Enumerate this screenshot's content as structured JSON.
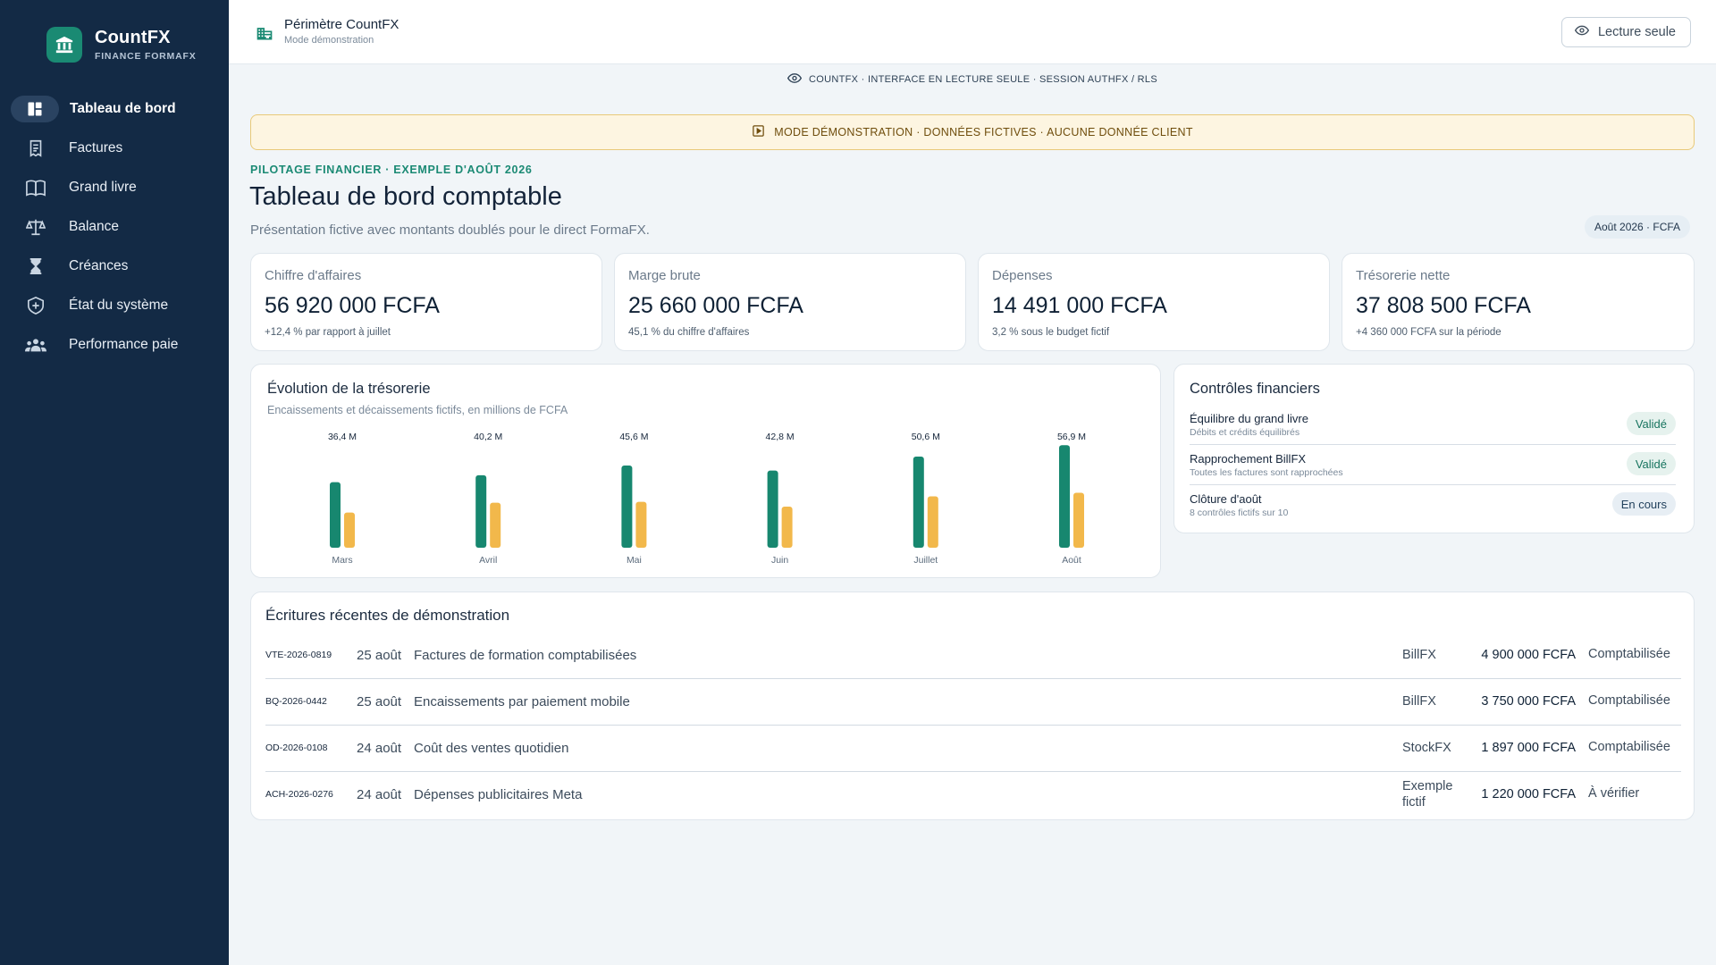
{
  "sidebar": {
    "brand_name": "CountFX",
    "brand_sub": "FINANCE FORMAFX",
    "items": [
      {
        "label": "Tableau de bord",
        "icon": "dashboard-icon"
      },
      {
        "label": "Factures",
        "icon": "receipt-icon"
      },
      {
        "label": "Grand livre",
        "icon": "book-icon"
      },
      {
        "label": "Balance",
        "icon": "scale-icon"
      },
      {
        "label": "Créances",
        "icon": "hourglass-icon"
      },
      {
        "label": "État du système",
        "icon": "shield-icon"
      },
      {
        "label": "Performance paie",
        "icon": "people-icon"
      }
    ]
  },
  "topbar": {
    "title": "Périmètre CountFX",
    "subtitle": "Mode démonstration",
    "readonly_label": "Lecture seule"
  },
  "session_bar": "COUNTFX · INTERFACE EN LECTURE SEULE · SESSION AUTHFX / RLS",
  "demo_banner": "MODE DÉMONSTRATION · DONNÉES FICTIVES · AUCUNE DONNÉE CLIENT",
  "header": {
    "kicker": "PILOTAGE FINANCIER · EXEMPLE D'AOÛT 2026",
    "title": "Tableau de bord comptable",
    "subtitle": "Présentation fictive avec montants doublés pour le direct FormaFX.",
    "period": "Août 2026 · FCFA"
  },
  "kpis": [
    {
      "label": "Chiffre d'affaires",
      "value": "56 920 000 FCFA",
      "note": "+12,4 % par rapport à juillet"
    },
    {
      "label": "Marge brute",
      "value": "25 660 000 FCFA",
      "note": "45,1 % du chiffre d'affaires"
    },
    {
      "label": "Dépenses",
      "value": "14 491 000 FCFA",
      "note": "3,2 % sous le budget fictif"
    },
    {
      "label": "Trésorerie nette",
      "value": "37 808 500 FCFA",
      "note": "+4 360 000 FCFA sur la période"
    }
  ],
  "treasury": {
    "title": "Évolution de la trésorerie",
    "subtitle": "Encaissements et décaissements fictifs, en millions de FCFA",
    "colors": {
      "inflow": "#17876f",
      "outflow": "#f2b84b"
    }
  },
  "chart_data": {
    "type": "bar",
    "categories": [
      "Mars",
      "Avril",
      "Mai",
      "Juin",
      "Juillet",
      "Août"
    ],
    "data_labels": [
      "36,4 M",
      "40,2 M",
      "45,6 M",
      "42,8 M",
      "50,6 M",
      "56,9 M"
    ],
    "series": [
      {
        "values": [
          36.4,
          40.2,
          45.6,
          42.8,
          50.6,
          56.9
        ]
      },
      {
        "values": [
          19.5,
          25.0,
          25.5,
          22.8,
          28.5,
          30.5
        ]
      }
    ],
    "title": "Évolution de la trésorerie",
    "ylim": [
      0,
      60
    ],
    "grid": false
  },
  "controls": {
    "title": "Contrôles financiers",
    "items": [
      {
        "label": "Équilibre du grand livre",
        "desc": "Débits et crédits équilibrés",
        "status": "Validé",
        "kind": "ok"
      },
      {
        "label": "Rapprochement BillFX",
        "desc": "Toutes les factures sont rapprochées",
        "status": "Validé",
        "kind": "ok"
      },
      {
        "label": "Clôture d'août",
        "desc": "8 contrôles fictifs sur 10",
        "status": "En cours",
        "kind": "prog"
      }
    ]
  },
  "entries": {
    "title": "Écritures récentes de démonstration",
    "rows": [
      {
        "id": "VTE-2026-0819",
        "date": "25 août",
        "desc": "Factures de formation comptabilisées",
        "source": "BillFX",
        "amount": "4 900 000 FCFA",
        "status": "Comptabilisée"
      },
      {
        "id": "BQ-2026-0442",
        "date": "25 août",
        "desc": "Encaissements par paiement mobile",
        "source": "BillFX",
        "amount": "3 750 000 FCFA",
        "status": "Comptabilisée"
      },
      {
        "id": "OD-2026-0108",
        "date": "24 août",
        "desc": "Coût des ventes quotidien",
        "source": "StockFX",
        "amount": "1 897 000 FCFA",
        "status": "Comptabilisée"
      },
      {
        "id": "ACH-2026-0276",
        "date": "24 août",
        "desc": "Dépenses publicitaires Meta",
        "source": "Exemple fictif",
        "amount": "1 220 000 FCFA",
        "status": "À vérifier"
      }
    ]
  }
}
